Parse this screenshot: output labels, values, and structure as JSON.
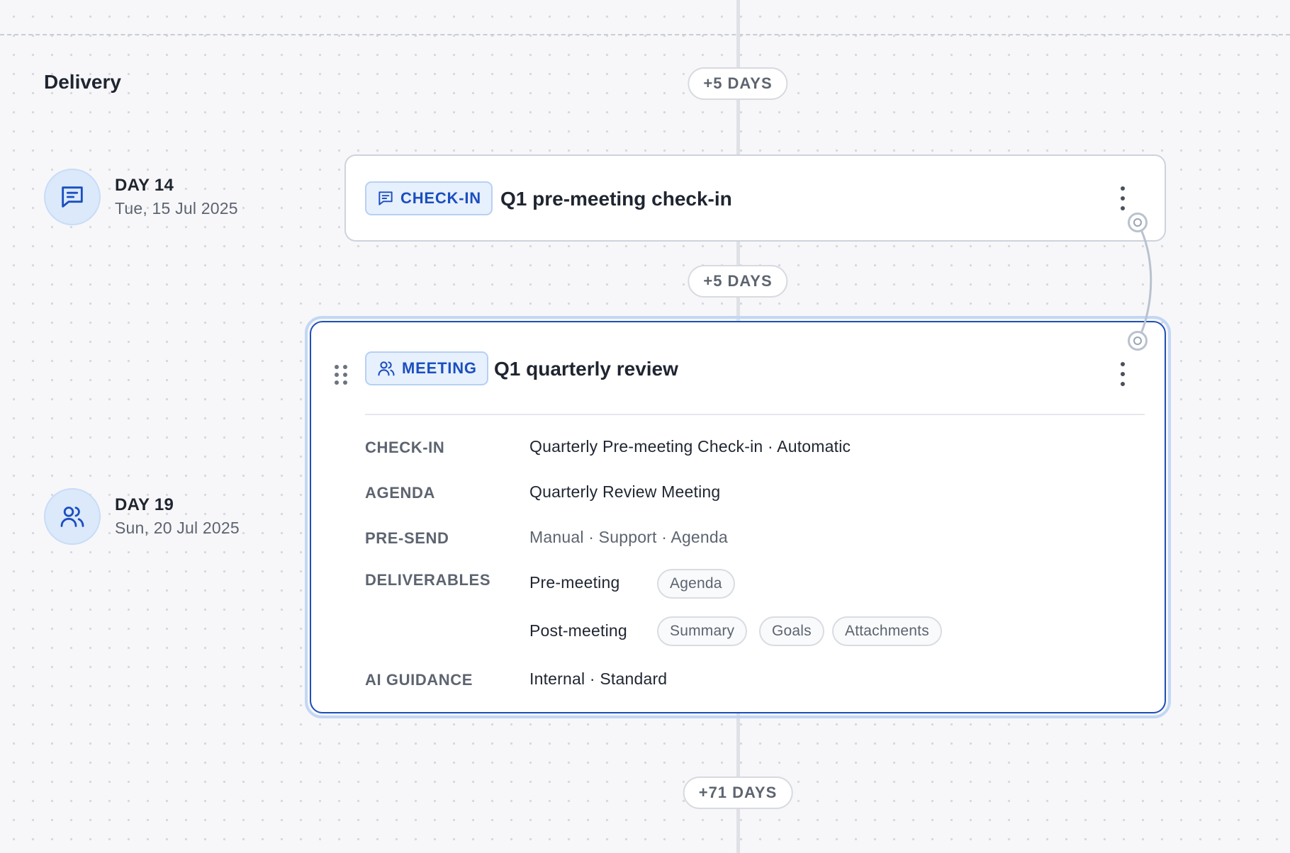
{
  "section": {
    "title": "Delivery"
  },
  "gaps": [
    {
      "label": "+5 DAYS"
    },
    {
      "label": "+5 DAYS"
    },
    {
      "label": "+71 DAYS"
    }
  ],
  "days": [
    {
      "label": "DAY 14",
      "date": "Tue, 15 Jul 2025",
      "icon": "chat-icon"
    },
    {
      "label": "DAY 19",
      "date": "Sun, 20 Jul 2025",
      "icon": "users-icon"
    }
  ],
  "events": {
    "checkin": {
      "badge": "CHECK-IN",
      "badge_icon": "chat-icon",
      "title": "Q1 pre-meeting check-in"
    },
    "meeting": {
      "badge": "MEETING",
      "badge_icon": "users-icon",
      "title": "Q1 quarterly review",
      "details": {
        "checkin": {
          "label": "CHECK-IN",
          "value": "Quarterly Pre-meeting Check-in · Automatic"
        },
        "agenda": {
          "label": "AGENDA",
          "value": "Quarterly Review Meeting"
        },
        "presend": {
          "label": "PRE-SEND",
          "value": "Manual · Support · Agenda"
        },
        "deliverables": {
          "label": "DELIVERABLES",
          "pre": {
            "label": "Pre-meeting",
            "chips": [
              "Agenda"
            ]
          },
          "post": {
            "label": "Post-meeting",
            "chips": [
              "Summary",
              "Goals",
              "Attachments"
            ]
          }
        },
        "ai": {
          "label": "AI GUIDANCE",
          "value": "Internal · Standard"
        }
      }
    }
  },
  "colors": {
    "accent": "#1e4fb8",
    "badge_bg": "#e7f0fd",
    "day_circle": "#dbe9fb",
    "background": "#f7f7f9"
  }
}
